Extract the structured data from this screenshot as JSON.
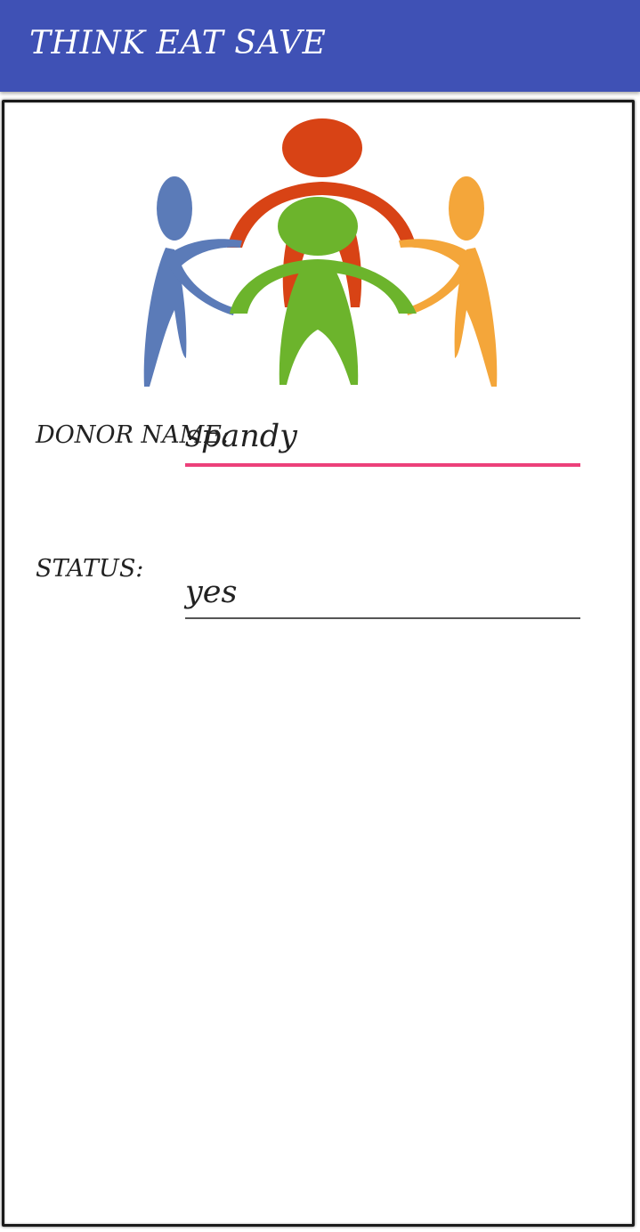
{
  "app_bar": {
    "title": "THINK EAT SAVE",
    "color": "#3f51b5"
  },
  "logo": {
    "icon": "people-circle-logo-icon",
    "colors": [
      "#d84315",
      "#5b7bb8",
      "#6cb42c",
      "#f4a63a"
    ]
  },
  "form": {
    "donor_name": {
      "label": "DONOR NAME:",
      "value": "spandy",
      "focused": true,
      "accent": "#ec407a"
    },
    "status": {
      "label": "STATUS:",
      "value": "yes"
    }
  }
}
